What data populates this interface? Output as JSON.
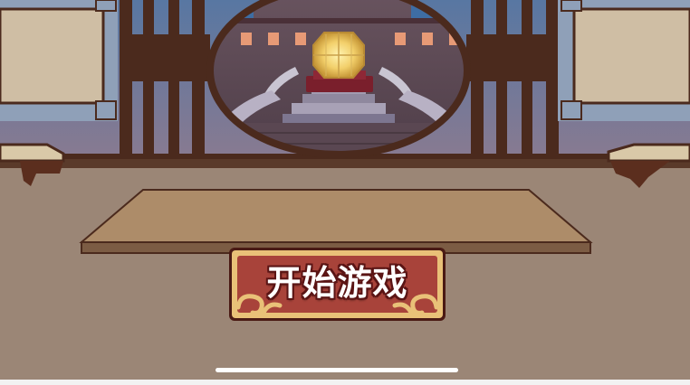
{
  "game": {
    "start_button_label": "开始游戏"
  },
  "colors": {
    "floor": "#9a8575",
    "wall_top": "#5a78a0",
    "wall_bottom": "#857790",
    "frame_dark": "#4a2a1c",
    "table_top": "#ad8c69",
    "button_red": "#a8433a",
    "button_border": "#e9c178",
    "lantern_glow": "#f5d97a"
  },
  "icons": {
    "lantern": "glowing-lantern-icon",
    "cloud_left": "auspicious-cloud-icon",
    "cloud_right": "auspicious-cloud-icon"
  }
}
